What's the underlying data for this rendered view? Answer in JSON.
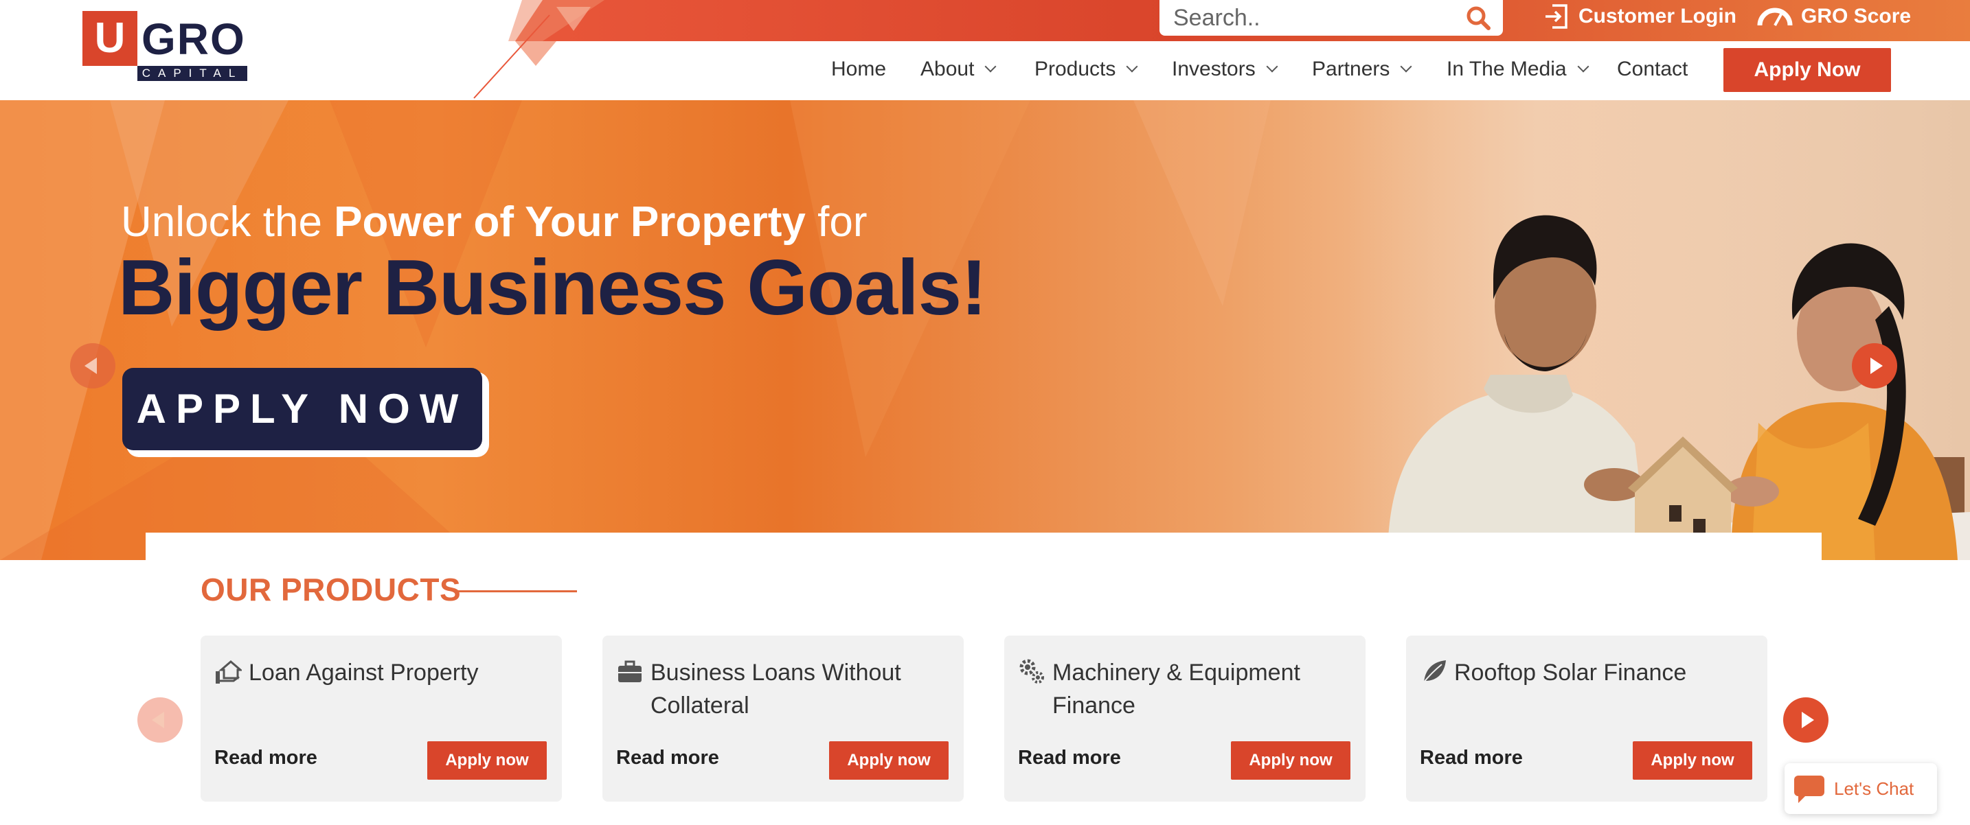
{
  "brand": {
    "logo_letter": "U",
    "logo_word": "GRO",
    "logo_sub": "CAPITAL",
    "accent": "#d9452b",
    "navy": "#1e2144",
    "orange": "#e2683c"
  },
  "search": {
    "placeholder": "Search.."
  },
  "top_links": {
    "customer_login": "Customer Login",
    "gro_score": "GRO Score"
  },
  "nav": {
    "items": [
      {
        "label": "Home",
        "dropdown": false
      },
      {
        "label": "About",
        "dropdown": true
      },
      {
        "label": "Products",
        "dropdown": true
      },
      {
        "label": "Investors",
        "dropdown": true
      },
      {
        "label": "Partners",
        "dropdown": true
      },
      {
        "label": "In The Media",
        "dropdown": true
      },
      {
        "label": "Contact",
        "dropdown": false
      }
    ],
    "apply_now": "Apply Now"
  },
  "hero": {
    "line1_pre": "Unlock the",
    "line1_bold": "Power of Your Property",
    "line1_post": "for",
    "line2": "Bigger Business Goals!",
    "cta": "APPLY NOW"
  },
  "products": {
    "title": "OUR PRODUCTS",
    "cards": [
      {
        "title": "Loan Against Property",
        "icon": "house-hand-icon",
        "read_more": "Read more",
        "apply": "Apply now"
      },
      {
        "title": "Business Loans Without Collateral",
        "icon": "briefcase-icon",
        "read_more": "Read more",
        "apply": "Apply now"
      },
      {
        "title": "Machinery & Equipment Finance",
        "icon": "gears-icon",
        "read_more": "Read more",
        "apply": "Apply now"
      },
      {
        "title": "Rooftop Solar Finance",
        "icon": "leaf-icon",
        "read_more": "Read more",
        "apply": "Apply now"
      }
    ]
  },
  "chat": {
    "label": "Let's Chat"
  }
}
